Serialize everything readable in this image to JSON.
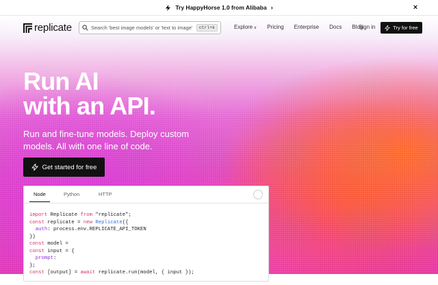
{
  "announcement": {
    "text": "Try HappyHorse 1.0 from Alibaba",
    "chevron": "›",
    "close": "×"
  },
  "nav": {
    "logo_text": "replicate",
    "search_placeholder": "Search 'best image models' or 'text to image'",
    "search_shortcut": "ctrl+k",
    "links": [
      "Explore",
      "Pricing",
      "Enterprise",
      "Docs",
      "Blog"
    ],
    "signin": "Sign in",
    "try_label": "Try for free"
  },
  "hero": {
    "headline_line1": "Run AI",
    "headline_line2": "with an API.",
    "subtitle": "Run and fine-tune models. Deploy custom models. All with one line of code.",
    "cta_label": "Get started for free"
  },
  "code_panel": {
    "tabs": [
      "Node",
      "Python",
      "HTTP"
    ],
    "active_tab": "Node",
    "lines": [
      "import Replicate from \"replicate\";",
      "const replicate = new Replicate({",
      "  auth: process.env.REPLICATE_API_TOKEN",
      "})",
      "const model =",
      "const input = {",
      "  prompt:",
      "};",
      "const [output] = await replicate.run(model, { input });"
    ]
  },
  "colors": {
    "brand_dark": "#111111",
    "gradient_pink": "#e14fc0",
    "gradient_orange": "#ff6e28"
  }
}
